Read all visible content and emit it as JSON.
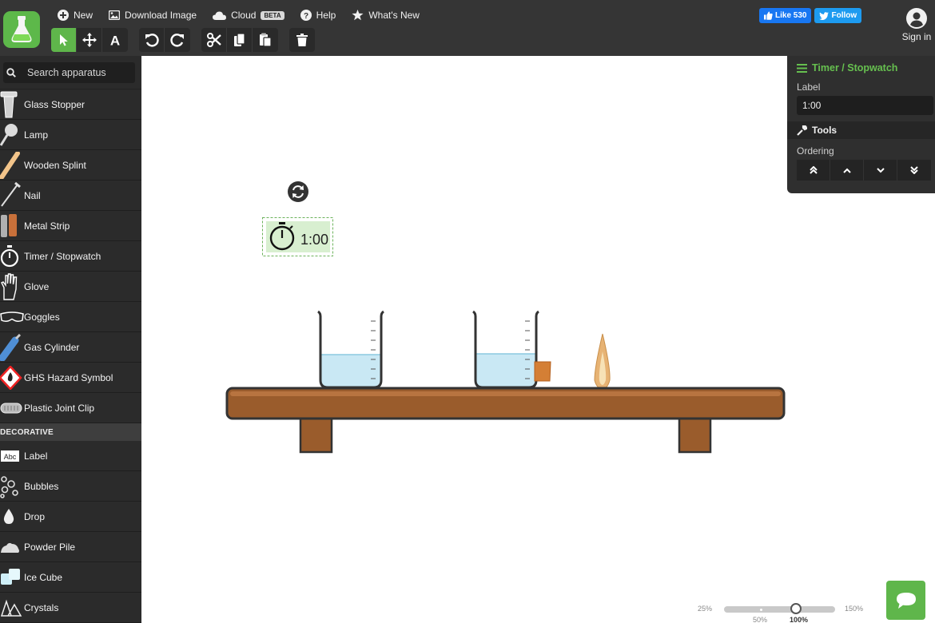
{
  "menu": {
    "new": "New",
    "download": "Download Image",
    "cloud": "Cloud",
    "beta": "BETA",
    "help": "Help",
    "whats_new": "What's New"
  },
  "social": {
    "like": "Like 530",
    "follow": "Follow"
  },
  "signin": "Sign in",
  "search": {
    "placeholder": "Search apparatus"
  },
  "apparatus": [
    {
      "label": "Glass Stopper",
      "icon": "glass-stopper-icon"
    },
    {
      "label": "Lamp",
      "icon": "lamp-icon"
    },
    {
      "label": "Wooden Splint",
      "icon": "wooden-splint-icon"
    },
    {
      "label": "Nail",
      "icon": "nail-icon"
    },
    {
      "label": "Metal Strip",
      "icon": "metal-strip-icon"
    },
    {
      "label": "Timer / Stopwatch",
      "icon": "stopwatch-icon"
    },
    {
      "label": "Glove",
      "icon": "glove-icon"
    },
    {
      "label": "Goggles",
      "icon": "goggles-icon"
    },
    {
      "label": "Gas Cylinder",
      "icon": "gas-cylinder-icon"
    },
    {
      "label": "GHS Hazard Symbol",
      "icon": "hazard-icon"
    },
    {
      "label": "Plastic Joint Clip",
      "icon": "joint-clip-icon"
    }
  ],
  "decorative_section": "DECORATIVE",
  "decorative": [
    {
      "label": "Label",
      "icon": "label-icon"
    },
    {
      "label": "Bubbles",
      "icon": "bubbles-icon"
    },
    {
      "label": "Drop",
      "icon": "drop-icon"
    },
    {
      "label": "Powder Pile",
      "icon": "powder-icon"
    },
    {
      "label": "Ice Cube",
      "icon": "ice-cube-icon"
    },
    {
      "label": "Crystals",
      "icon": "crystals-icon"
    }
  ],
  "canvas": {
    "timer_text": "1:00"
  },
  "panel": {
    "title": "Timer / Stopwatch",
    "label_heading": "Label",
    "label_value": "1:00",
    "tools_heading": "Tools",
    "ordering_heading": "Ordering"
  },
  "zoom": {
    "min": "25%",
    "max": "150%",
    "tick_50": "50%",
    "tick_100": "100%",
    "value_percent": 100
  },
  "colors": {
    "accent": "#5fb64b",
    "topbar": "#353535",
    "sidebar": "#2b2b2b",
    "bench": "#9a5c2c"
  }
}
